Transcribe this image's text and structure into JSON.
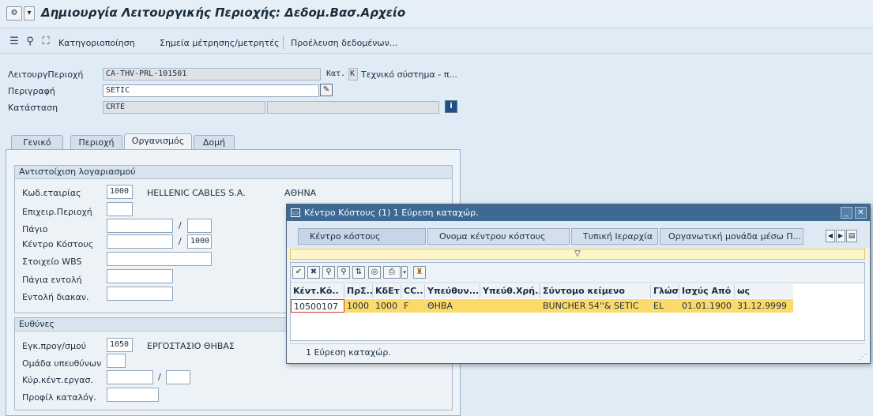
{
  "window": {
    "title": "Δημιουργία Λειτουργικής Περιοχής: Δεδομ.Βασ.Αρχείο"
  },
  "toolbar": {
    "items": [
      "Κατηγοριοποίηση",
      "Σημεία μέτρησης/μετρητές",
      "Προέλευση δεδομένων..."
    ]
  },
  "header": {
    "func_loc": {
      "label": "ΛειτουργΠεριοχή",
      "value": "CA-THV-PRL-101501",
      "cat_label": "Κατ.",
      "cat_value": "K",
      "cat_text": "Τεχνικό σύστημα - π..."
    },
    "description": {
      "label": "Περιγραφή",
      "value": "SETIC"
    },
    "status": {
      "label": "Κατάσταση",
      "value": "CRTE",
      "value2": ""
    }
  },
  "tabs": [
    {
      "label": "Γενικό",
      "active": false
    },
    {
      "label": "Περιοχή",
      "active": false
    },
    {
      "label": "Οργανισμός",
      "active": true
    },
    {
      "label": "Δομή",
      "active": false
    }
  ],
  "account": {
    "title": "Αντιστοίχιση λογαριασμού",
    "company": {
      "label": "Κωδ.εταιρίας",
      "value": "1000",
      "name": "HELLENIC CABLES S.A.",
      "city": "ΑΘΗΝΑ"
    },
    "business_area": {
      "label": "Επιχειρ.Περιοχή",
      "value": ""
    },
    "asset": {
      "label": "Πάγιο",
      "value": "",
      "sub": ""
    },
    "cost_center": {
      "label": "Κέντρο Κόστους",
      "value": "",
      "sub": "1000"
    },
    "wbs": {
      "label": "Στοιχείο WBS",
      "value": ""
    },
    "asset_order": {
      "label": "Πάγια εντολή",
      "value": ""
    },
    "settlement_order": {
      "label": "Εντολή διακαν.",
      "value": ""
    },
    "slash": "/"
  },
  "resp": {
    "title": "Ευθύνες",
    "planning_plant": {
      "label": "Εγκ.προγ/σμού",
      "value": "1050",
      "name": "ΕΡΓΟΣΤΑΣΙΟ ΘΗΒΑΣ"
    },
    "planner_group": {
      "label": "Ομάδα υπευθύνων",
      "value": ""
    },
    "main_work_center": {
      "label": "Κύρ.κέντ.εργασ.",
      "value": "",
      "sub": ""
    },
    "catalog_profile": {
      "label": "Προφίλ καταλόγ.",
      "value": ""
    }
  },
  "dialog": {
    "title": "Κέντρο Κόστους (1)   1 Εύρεση καταχώρ.",
    "tabs": [
      "Κέντρο κόστους",
      "Ονομα κέντρου κόστους",
      "Τυπική Ιεραρχία",
      "Οργανωτική μονάδα μέσω Π..."
    ],
    "columns": [
      "Κέντ.Κό..",
      "ΠρΣ..",
      "ΚδΕτ",
      "CC..",
      "Υπεύθυν...",
      "Υπεύθ.Χρή...",
      "Σύντομο κείμενο",
      "Γλώσ..",
      "Ισχύς Από",
      "ως"
    ],
    "rows": [
      [
        "10500107",
        "1000",
        "1000",
        "F",
        "ΘΗΒΑ",
        "",
        "BUNCHER 54''& SETIC",
        "EL",
        "01.01.1900",
        "31.12.9999"
      ]
    ],
    "status": "1 Εύρεση καταχώρ."
  },
  "colors": {
    "title_bar": "#3d6993",
    "selected_row": "#fbd96b",
    "background": "#dfebf5"
  }
}
